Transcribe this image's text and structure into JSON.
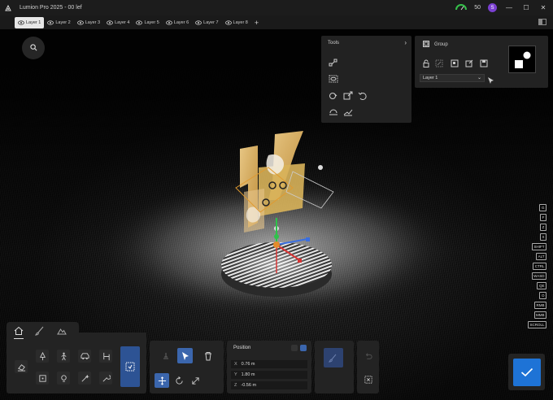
{
  "app": {
    "title": "Lumion Pro 2025 - 00 lef",
    "fps": "50",
    "user_initial": "S",
    "window": {
      "minimize": "—",
      "maximize": "☐",
      "close": "✕"
    }
  },
  "layers": {
    "tabs": [
      {
        "label": "Layer 1",
        "active": true
      },
      {
        "label": "Layer 2"
      },
      {
        "label": "Layer 3"
      },
      {
        "label": "Layer 4"
      },
      {
        "label": "Layer 5"
      },
      {
        "label": "Layer 6"
      },
      {
        "label": "Layer 7"
      },
      {
        "label": "Layer 8"
      }
    ],
    "add_label": "+"
  },
  "tools_panel": {
    "title": "Tools",
    "chevron": "›",
    "icons": [
      "move-icon",
      "select-visible-icon",
      "paint-icon",
      "export-icon",
      "undo-icon",
      "ground-snap-icon",
      "terrain-icon"
    ]
  },
  "group_panel": {
    "title": "Group",
    "icons": [
      "lock-icon",
      "focus-icon",
      "group-icon",
      "ungroup-icon",
      "save-icon"
    ],
    "layer_select": "Layer 1"
  },
  "shortcut_keys": [
    "G",
    "F",
    "Z",
    "X",
    "SHIFT",
    "ALT",
    "CTRL",
    "WASD",
    "QE",
    "O",
    "RMB",
    "MMB",
    "SCROLL"
  ],
  "position": {
    "title": "Position",
    "x_label": "X",
    "x_value": "0.76 m",
    "y_label": "Y",
    "y_value": "1.80 m",
    "z_label": "Z",
    "z_value": "-0.56 m"
  },
  "colors": {
    "accent": "#2d5394",
    "confirm": "#1e73d6",
    "avatar": "#7a3fd0",
    "fps_gauge": "#35c04a"
  }
}
